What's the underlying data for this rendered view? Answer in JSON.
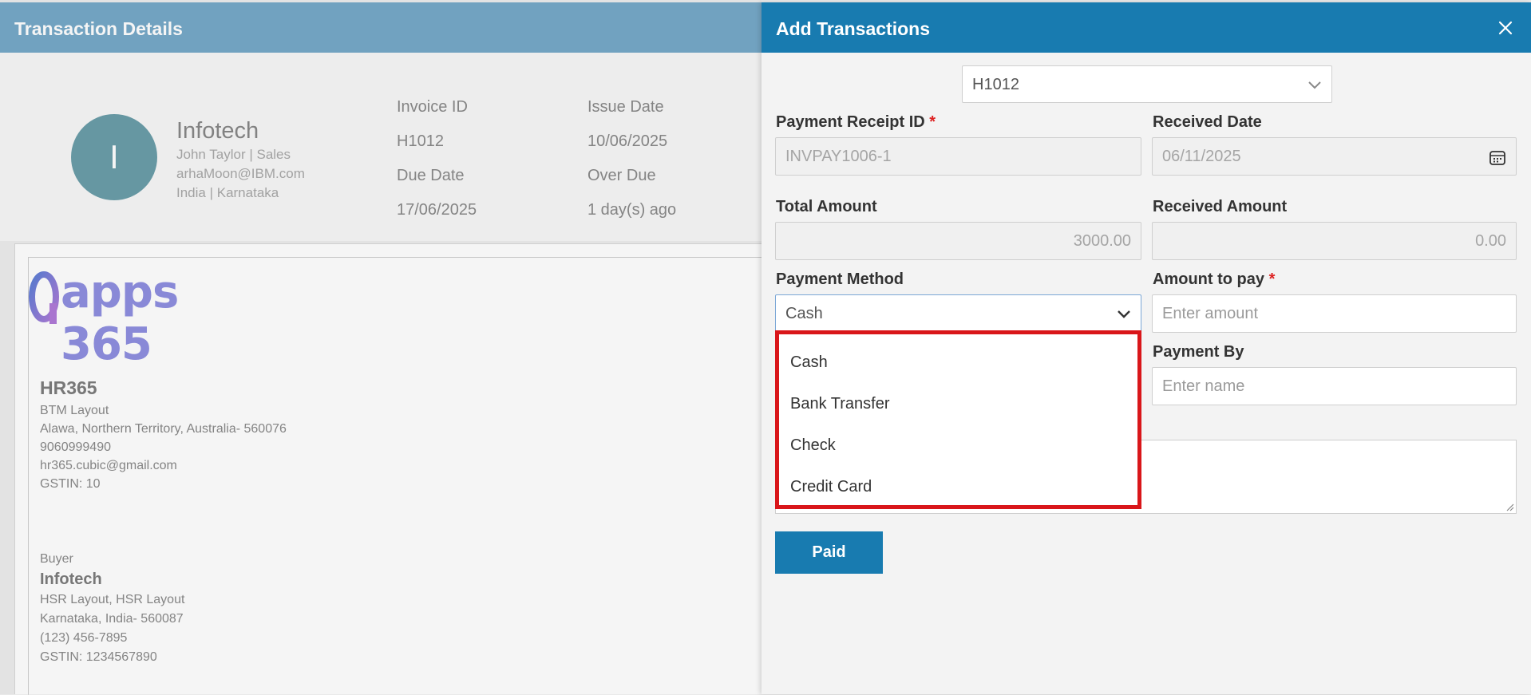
{
  "left": {
    "header_title": "Transaction Details",
    "avatar_letter": "I",
    "company": {
      "name": "Infotech",
      "contact": "John Taylor | Sales",
      "email": "arhaMoon@IBM.com",
      "location": "India | Karnataka"
    },
    "meta": {
      "invoice_id_label": "Invoice ID",
      "invoice_id_value": "H1012",
      "issue_date_label": "Issue Date",
      "issue_date_value": "10/06/2025",
      "due_date_label": "Due Date",
      "due_date_value": "17/06/2025",
      "over_due_label": "Over Due",
      "over_due_value": "1 day(s) ago"
    },
    "invoice": {
      "logo_text": "apps 365",
      "seller_name": "HR365",
      "seller_lines": [
        "BTM Layout",
        "Alawa, Northern Territory, Australia- 560076",
        "9060999490",
        "hr365.cubic@gmail.com",
        "GSTIN: 10"
      ],
      "buyer_label": "Buyer",
      "buyer_name": "Infotech",
      "buyer_lines": [
        "HSR Layout, HSR Layout",
        "Karnataka, India- 560087",
        "(123) 456-7895",
        "GSTIN: 1234567890"
      ]
    }
  },
  "panel": {
    "title": "Add Transactions",
    "invoice_select_value": "H1012",
    "payment_receipt_id_label": "Payment Receipt ID",
    "payment_receipt_id_value": "INVPAY1006-1",
    "received_date_label": "Received Date",
    "received_date_value": "06/11/2025",
    "total_amount_label": "Total Amount",
    "total_amount_value": "3000.00",
    "received_amount_label": "Received Amount",
    "received_amount_value": "0.00",
    "payment_method_label": "Payment Method",
    "payment_method_value": "Cash",
    "payment_method_options": [
      "Cash",
      "Bank Transfer",
      "Check",
      "Credit Card"
    ],
    "amount_to_pay_label": "Amount to pay",
    "amount_to_pay_placeholder": "Enter amount",
    "payment_by_label": "Payment By",
    "payment_by_placeholder": "Enter name",
    "required_mark": "*",
    "paid_button": "Paid"
  },
  "colors": {
    "panel_header": "#187bb0",
    "left_header": "#76a9c8",
    "highlight_border": "#d9161a"
  }
}
